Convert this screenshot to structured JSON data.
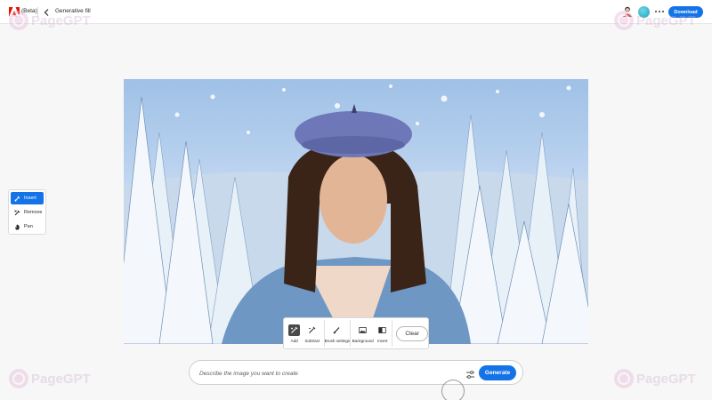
{
  "header": {
    "beta_label": "(Beta)",
    "title": "Generative fill",
    "download_label": "Download"
  },
  "watermark_text": "PageGPT",
  "tools": {
    "items": [
      {
        "label": "Insert",
        "icon": "insert-brush-icon",
        "active": true
      },
      {
        "label": "Remove",
        "icon": "remove-brush-icon",
        "active": false
      },
      {
        "label": "Pan",
        "icon": "hand-icon",
        "active": false
      }
    ]
  },
  "brush_toolbar": {
    "add_label": "Add",
    "subtract_label": "Subtract",
    "brush_settings_label": "Brush settings",
    "background_label": "Background",
    "invert_label": "Invert",
    "clear_label": "Clear"
  },
  "prompt": {
    "placeholder": "Describe the image you want to create",
    "value": "",
    "generate_label": "Generate"
  },
  "colors": {
    "accent": "#1473e6",
    "adobe_red": "#eb1000",
    "avatar_teal": "#1ea3c2"
  }
}
